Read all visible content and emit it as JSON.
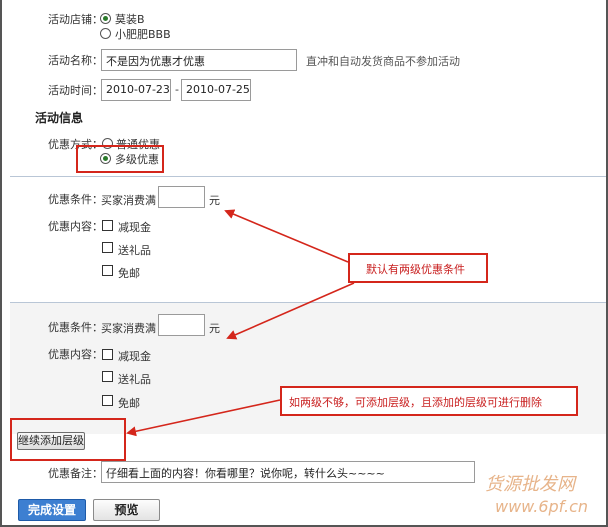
{
  "store": {
    "label": "活动店铺：",
    "options": [
      {
        "label": "莫装B",
        "selected": true
      },
      {
        "label": "小肥肥BBB",
        "selected": false
      }
    ]
  },
  "name": {
    "label": "活动名称：",
    "value": "不是因为优惠才优惠",
    "hint": "直冲和自动发货商品不参加活动"
  },
  "time": {
    "label": "活动时间：",
    "start": "2010-07-23",
    "separator": "-",
    "end": "2010-07-25"
  },
  "info": {
    "title": "活动信息",
    "method_label": "优惠方式：",
    "methods": [
      {
        "label": "普通优惠",
        "selected": false
      },
      {
        "label": "多级优惠",
        "selected": true
      }
    ]
  },
  "tiers": [
    {
      "condition_label": "优惠条件：",
      "condition_prefix": "买家消费满",
      "condition_value": "",
      "condition_unit": "元",
      "content_label": "优惠内容：",
      "contents": [
        {
          "label": "减现金",
          "checked": false
        },
        {
          "label": "送礼品",
          "checked": false
        },
        {
          "label": "免邮",
          "checked": false
        }
      ]
    },
    {
      "condition_label": "优惠条件：",
      "condition_prefix": "买家消费满",
      "condition_value": "",
      "condition_unit": "元",
      "content_label": "优惠内容：",
      "contents": [
        {
          "label": "减现金",
          "checked": false
        },
        {
          "label": "送礼品",
          "checked": false
        },
        {
          "label": "免邮",
          "checked": false
        }
      ]
    }
  ],
  "add_tier_button": "继续添加层级",
  "remark": {
    "label": "优惠备注：",
    "value": "仔细看上面的内容！你看哪里？说你呢，转什么头~~~~"
  },
  "buttons": {
    "finish": "完成设置",
    "preview": "预览"
  },
  "callouts": {
    "default_tiers": "默认有两级优惠条件",
    "add_more": "如两级不够，可添加层级，且添加的层级可进行删除"
  },
  "watermark": {
    "cn": "货源批发网",
    "url": "www.6pf.cn"
  },
  "colors": {
    "annotation_red": "#d4261b",
    "primary_button": "#3d7fd1",
    "watermark": "#e7b48a"
  }
}
